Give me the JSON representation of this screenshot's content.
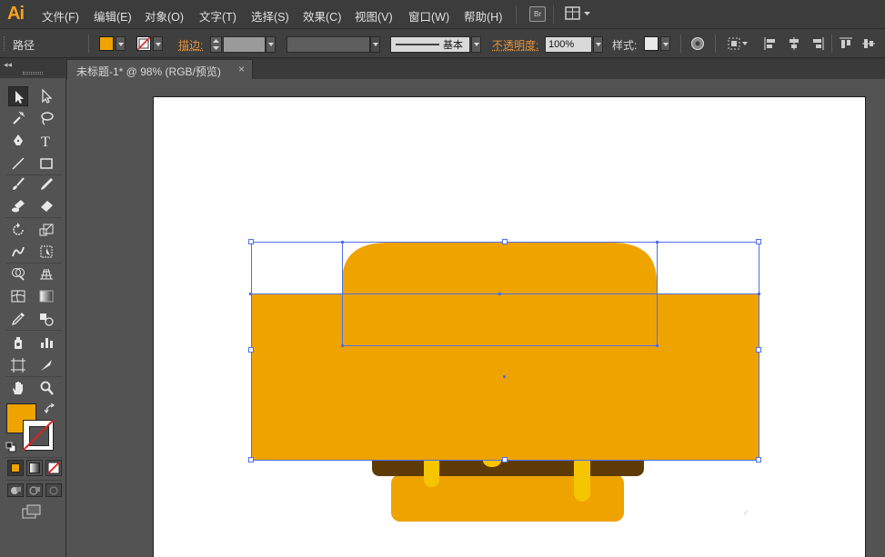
{
  "app": {
    "logo": "Ai"
  },
  "menu": [
    {
      "label": "文件(F)",
      "name": "menu-file"
    },
    {
      "label": "编辑(E)",
      "name": "menu-edit"
    },
    {
      "label": "对象(O)",
      "name": "menu-object"
    },
    {
      "label": "文字(T)",
      "name": "menu-type"
    },
    {
      "label": "选择(S)",
      "name": "menu-select"
    },
    {
      "label": "效果(C)",
      "name": "menu-effect"
    },
    {
      "label": "视图(V)",
      "name": "menu-view"
    },
    {
      "label": "窗口(W)",
      "name": "menu-window"
    },
    {
      "label": "帮助(H)",
      "name": "menu-help"
    }
  ],
  "bridge_label": "Br",
  "control": {
    "selection_type": "路径",
    "stroke_label": "描边:",
    "stroke_profile": "基本",
    "opacity_label": "不透明度:",
    "opacity_value": "100%",
    "style_label": "样式:"
  },
  "document_tab": {
    "title": "未标题-1* @ 98% (RGB/预览)",
    "close": "×"
  },
  "colors": {
    "fill": "#efa301",
    "dark_brown": "#5e3b06",
    "drip_yellow": "#f4c500",
    "selection": "#4f6fe8",
    "menu_accent": "#f7a21b"
  },
  "tools": [
    [
      "selection-tool-icon",
      "direct-selection-tool-icon"
    ],
    [
      "magic-wand-tool-icon",
      "lasso-tool-icon"
    ],
    [
      "pen-tool-icon",
      "type-tool-icon"
    ],
    [
      "line-segment-tool-icon",
      "rectangle-tool-icon"
    ],
    [
      "paintbrush-tool-icon",
      "pencil-tool-icon"
    ],
    [
      "blob-brush-tool-icon",
      "eraser-tool-icon"
    ],
    [
      "rotate-tool-icon",
      "scale-tool-icon"
    ],
    [
      "warp-tool-icon",
      "free-transform-tool-icon"
    ],
    [
      "shape-builder-tool-icon",
      "perspective-grid-tool-icon"
    ],
    [
      "mesh-tool-icon",
      "gradient-tool-icon"
    ],
    [
      "eyedropper-tool-icon",
      "blend-tool-icon"
    ],
    [
      "symbol-sprayer-tool-icon",
      "column-graph-tool-icon"
    ],
    [
      "artboard-tool-icon",
      "slice-tool-icon"
    ],
    [
      "hand-tool-icon",
      "zoom-tool-icon"
    ]
  ]
}
